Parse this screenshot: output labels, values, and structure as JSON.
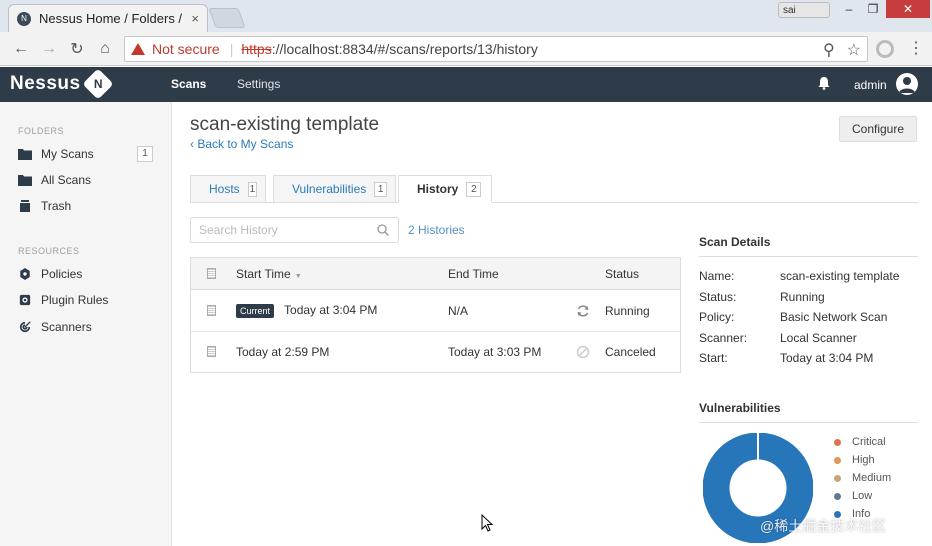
{
  "browser": {
    "tab_title": "Nessus Home / Folders /",
    "tab_close": "×",
    "profile_label": "sai",
    "security_warning": "Not secure",
    "url_scheme": "https",
    "url_rest": "://localhost:8834/#/scans/reports/13/history",
    "window_min": "–",
    "window_max": "❐",
    "window_close": "✕",
    "back": "←",
    "forward": "→",
    "reload": "↻",
    "home": "⌂",
    "zoom": "⚲",
    "star": "☆",
    "menu": "⋮"
  },
  "app": {
    "logo": "Nessus",
    "logo_badge": "N",
    "nav": {
      "scans": "Scans",
      "settings": "Settings"
    },
    "user": "admin"
  },
  "sidebar": {
    "folders_heading": "FOLDERS",
    "resources_heading": "RESOURCES",
    "folders": [
      {
        "label": "My Scans",
        "count": "1",
        "icon": "folder-icon"
      },
      {
        "label": "All Scans",
        "icon": "folder-icon"
      },
      {
        "label": "Trash",
        "icon": "trash-icon"
      }
    ],
    "resources": [
      {
        "label": "Policies",
        "icon": "policy-icon"
      },
      {
        "label": "Plugin Rules",
        "icon": "plugin-icon"
      },
      {
        "label": "Scanners",
        "icon": "scanner-icon"
      }
    ]
  },
  "main": {
    "title": "scan-existing template",
    "back_link": "‹ Back to My Scans",
    "configure": "Configure",
    "tabs": [
      {
        "label": "Hosts",
        "count": "1"
      },
      {
        "label": "Vulnerabilities",
        "count": "1"
      },
      {
        "label": "History",
        "count": "2",
        "active": true
      }
    ],
    "search_placeholder": "Search History",
    "histories_count": "2 Histories",
    "table": {
      "headers": {
        "start": "Start Time",
        "end": "End Time",
        "status": "Status"
      },
      "rows": [
        {
          "badge": "Current",
          "start": "Today at 3:04 PM",
          "end": "N/A",
          "status": "Running",
          "status_icon": "running-icon"
        },
        {
          "start": "Today at 2:59 PM",
          "end": "Today at 3:03 PM",
          "status": "Canceled",
          "status_icon": "canceled-icon"
        }
      ]
    }
  },
  "scan_details": {
    "title": "Scan Details",
    "fields": [
      {
        "label": "Name:",
        "value": "scan-existing template"
      },
      {
        "label": "Status:",
        "value": "Running"
      },
      {
        "label": "Policy:",
        "value": "Basic Network Scan"
      },
      {
        "label": "Scanner:",
        "value": "Local Scanner"
      },
      {
        "label": "Start:",
        "value": "Today at 3:04 PM"
      }
    ]
  },
  "vulnerabilities": {
    "title": "Vulnerabilities",
    "legend": [
      {
        "label": "Critical",
        "color": "#d9744f"
      },
      {
        "label": "High",
        "color": "#e0965a"
      },
      {
        "label": "Medium",
        "color": "#c9a277"
      },
      {
        "label": "Low",
        "color": "#5f7b8f"
      },
      {
        "label": "Info",
        "color": "#2676b9"
      }
    ],
    "info_share": 1.0
  },
  "watermark": "@稀土掘金技术社区",
  "colors": {
    "header_bg": "#2e3b49",
    "link": "#2b7bb9",
    "info": "#2676b9"
  }
}
